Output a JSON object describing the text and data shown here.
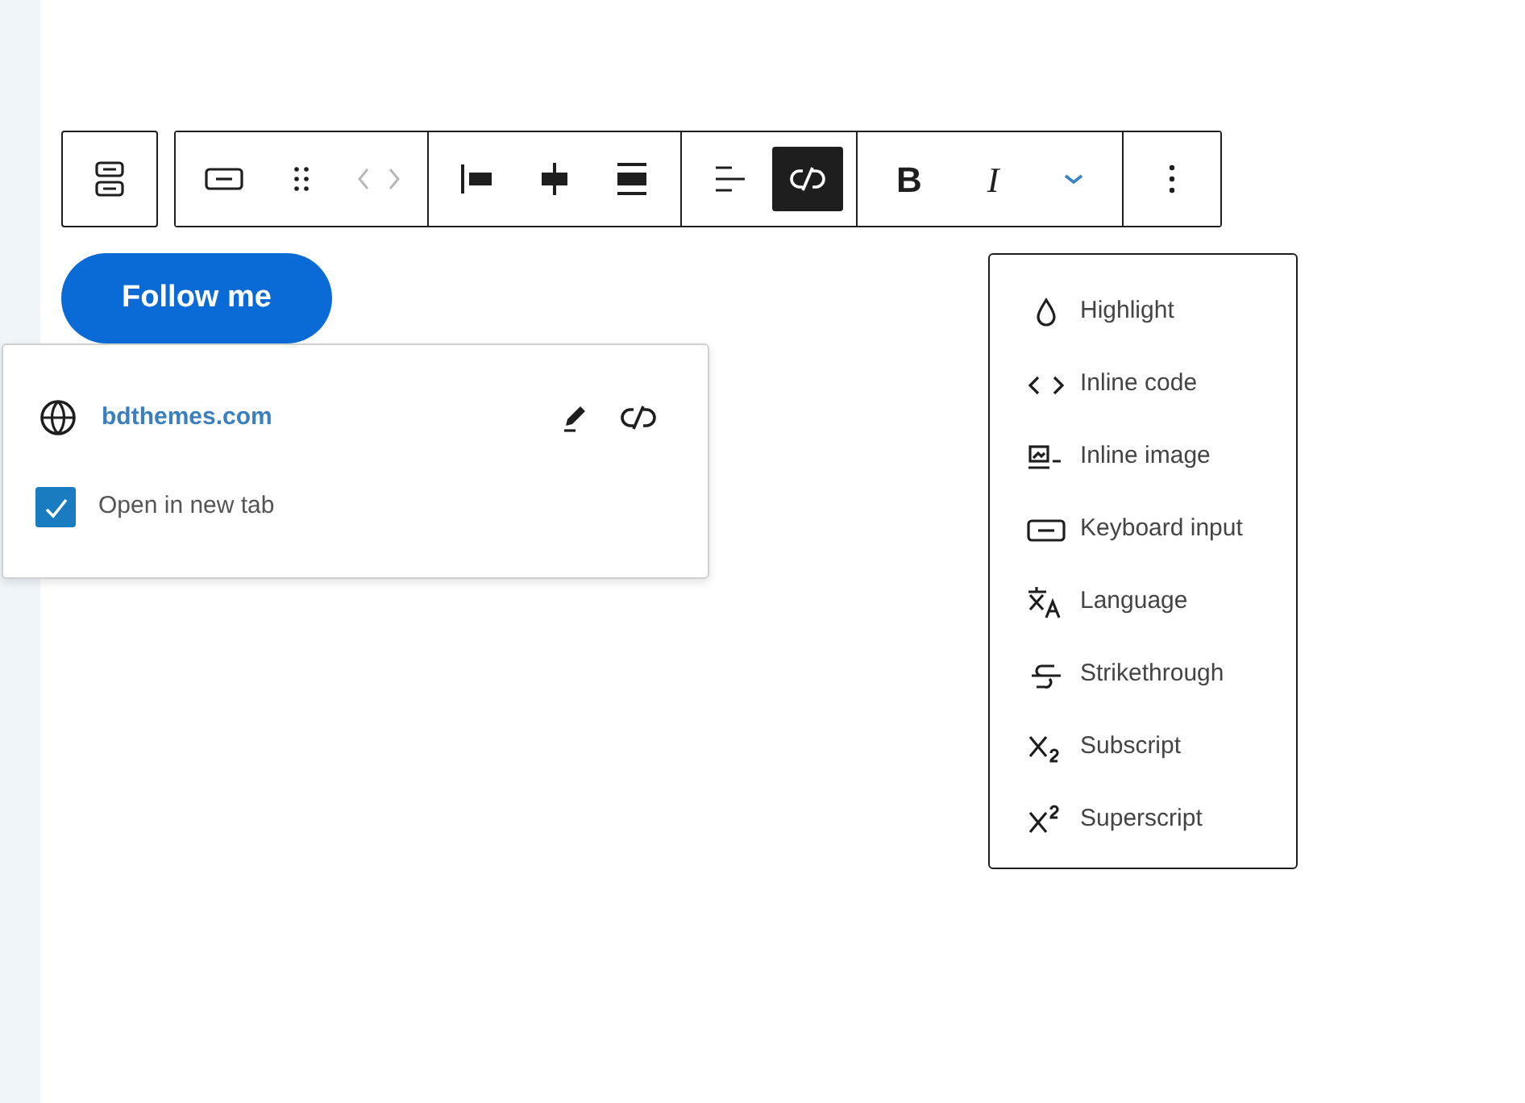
{
  "toolbar": {
    "groups": [
      [
        {
          "kind": "block-type"
        }
      ],
      [
        {
          "kind": "button-block"
        },
        {
          "kind": "drag"
        },
        {
          "kind": "move",
          "disabled": true
        }
      ],
      [
        {
          "kind": "justify-left"
        },
        {
          "kind": "justify-center"
        },
        {
          "kind": "justify-stretch"
        }
      ],
      [
        {
          "kind": "align"
        },
        {
          "kind": "unlink",
          "selected": true
        }
      ],
      [
        {
          "kind": "bold",
          "label": "B"
        },
        {
          "kind": "italic",
          "label": "I"
        },
        {
          "kind": "more-formats",
          "expanded": true
        }
      ],
      [
        {
          "kind": "options"
        }
      ]
    ]
  },
  "button": {
    "label": "Follow me"
  },
  "link_popover": {
    "url": "bdthemes.com",
    "open_in_new_tab": {
      "label": "Open in new tab",
      "checked": true
    }
  },
  "format_menu": [
    {
      "kind": "highlight",
      "label": "Highlight"
    },
    {
      "kind": "code",
      "label": "Inline code"
    },
    {
      "kind": "image",
      "label": "Inline image"
    },
    {
      "kind": "keyboard",
      "label": "Keyboard input"
    },
    {
      "kind": "language",
      "label": "Language"
    },
    {
      "kind": "strike",
      "label": "Strikethrough"
    },
    {
      "kind": "subscript",
      "label": "Subscript"
    },
    {
      "kind": "superscript",
      "label": "Superscript"
    }
  ]
}
